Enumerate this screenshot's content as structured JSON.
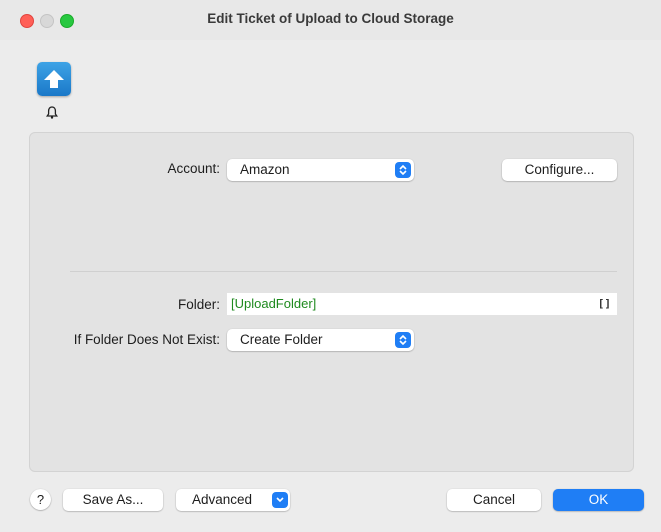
{
  "window": {
    "title": "Edit Ticket of Upload to Cloud Storage"
  },
  "icons": {
    "app": "upload-arrow-icon",
    "notification": "bell-icon"
  },
  "colors": {
    "accent": "#1f7ef5",
    "variable_text": "#1f8a1f"
  },
  "account": {
    "label": "Account:",
    "value": "Amazon",
    "configure_label": "Configure..."
  },
  "folder": {
    "label": "Folder:",
    "value": "[UploadFolder]",
    "picker_glyph": "[]"
  },
  "missing_folder": {
    "label": "If Folder Does Not Exist:",
    "value": "Create Folder"
  },
  "footer": {
    "help_label": "?",
    "save_as_label": "Save As...",
    "advanced_label": "Advanced",
    "cancel_label": "Cancel",
    "ok_label": "OK"
  }
}
